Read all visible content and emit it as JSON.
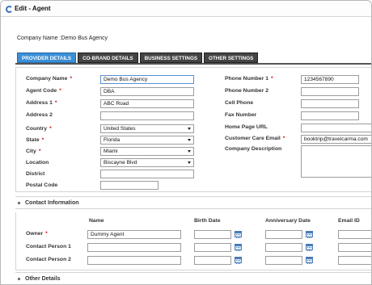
{
  "window": {
    "title": "Edit - Agent"
  },
  "company": {
    "label": "Company Name",
    "value": ":Demo Bus Agency"
  },
  "tabs": [
    "PROVIDER DETAILS",
    "CO-BRAND DETAILS",
    "BUSINESS SETTINGS",
    "OTHER SETTINGS"
  ],
  "active_tab": "PROVIDER DETAILS",
  "left_fields": {
    "company_name": {
      "label": "Company Name",
      "value": "Demo Bus Agency"
    },
    "agent_code": {
      "label": "Agent Code",
      "value": "DBA"
    },
    "address1": {
      "label": "Address 1",
      "value": "ABC Road"
    },
    "address2": {
      "label": "Address 2",
      "value": ""
    },
    "country": {
      "label": "Country",
      "value": "United States"
    },
    "state": {
      "label": "State",
      "value": "Florida"
    },
    "city": {
      "label": "City",
      "value": "Miami"
    },
    "location": {
      "label": "Location",
      "value": "Biscayne Blvd"
    },
    "district": {
      "label": "District",
      "value": ""
    },
    "postal_code": {
      "label": "Postal Code",
      "value": ""
    }
  },
  "right_fields": {
    "phone1": {
      "label": "Phone Number 1",
      "value": "1234567890"
    },
    "phone2": {
      "label": "Phone Number 2",
      "value": ""
    },
    "cell": {
      "label": "Cell Phone",
      "value": ""
    },
    "fax": {
      "label": "Fax Number",
      "value": ""
    },
    "homepage": {
      "label": "Home Page URL",
      "value": ""
    },
    "email": {
      "label": "Customer Care Email",
      "value": "booktrip@travelcarma.com"
    },
    "description": {
      "label": "Company Description",
      "value": ""
    }
  },
  "required_mark": "*",
  "contact": {
    "title": "Contact Information",
    "columns": {
      "name": "Name",
      "birth": "Birth Date",
      "anniversary": "Anniversary Date",
      "email": "Email ID"
    },
    "rows": [
      {
        "label": "Owner",
        "required": true,
        "name": "Dummy Agent"
      },
      {
        "label": "Contact Person 1",
        "required": false,
        "name": ""
      },
      {
        "label": "Contact Person 2",
        "required": false,
        "name": ""
      }
    ]
  },
  "other": {
    "title": "Other Details"
  },
  "colors": {
    "accent": "#3a8fd6",
    "tab_dark": "#444444",
    "required": "#d01010"
  }
}
